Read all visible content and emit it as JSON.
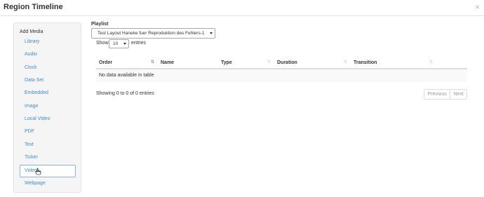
{
  "window": {
    "title": "Region Timeline",
    "close_glyph": "×"
  },
  "sidebar": {
    "heading": "Add Media",
    "items": [
      {
        "label": "Library"
      },
      {
        "label": "Audio"
      },
      {
        "label": "Clock"
      },
      {
        "label": "Data Set"
      },
      {
        "label": "Embedded"
      },
      {
        "label": "Image"
      },
      {
        "label": "Local Video"
      },
      {
        "label": "PDF"
      },
      {
        "label": "Text"
      },
      {
        "label": "Ticker"
      },
      {
        "label": "Video"
      },
      {
        "label": "Webpage"
      }
    ],
    "active_item": "Video"
  },
  "playlist": {
    "label": "Playlist",
    "selected": "Test Layout Haneke fuer Reproduktion des Fehlers-1"
  },
  "length_menu": {
    "show_label": "Show",
    "value": "10",
    "entries_label": "entries"
  },
  "table": {
    "columns": [
      "Order",
      "Name",
      "Type",
      "Duration",
      "Transition"
    ],
    "empty_message": "No data available in table"
  },
  "info": "Showing 0 to 0 of 0 entries",
  "pagination": {
    "previous": "Previous",
    "next": "Next"
  },
  "colors": {
    "link": "#428bca",
    "sidebar_bg": "#f5f5f5",
    "active_border": "#8cb4d8"
  }
}
